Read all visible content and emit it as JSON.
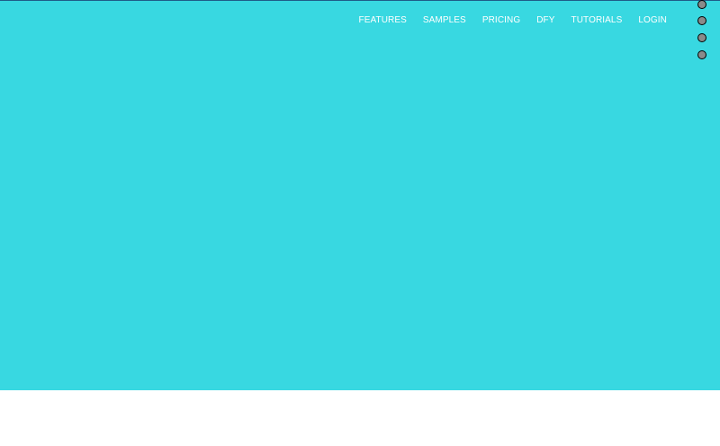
{
  "theme": {
    "hero_background": "#38d8e1",
    "nav_text_color": "#ffffff",
    "dot_fill": "#8a8a8a"
  },
  "nav": {
    "items": [
      {
        "label": "FEATURES"
      },
      {
        "label": "SAMPLES"
      },
      {
        "label": "PRICING"
      },
      {
        "label": "DFY"
      },
      {
        "label": "TUTORIALS"
      },
      {
        "label": "LOGIN"
      }
    ]
  }
}
